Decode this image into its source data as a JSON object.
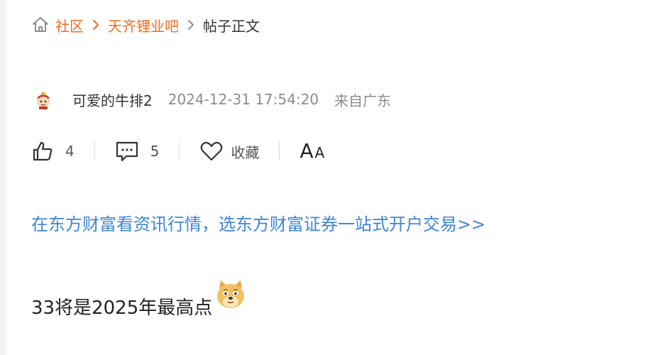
{
  "breadcrumb": {
    "home_icon": "home-icon",
    "items": [
      {
        "label": "社区"
      },
      {
        "label": "天齐锂业吧"
      }
    ],
    "current": "帖子正文",
    "separator_icon": "chevron-right-icon"
  },
  "author": {
    "avatar_icon": "avatar",
    "name": "可爱的牛排2",
    "time": "2024-12-31 17:54:20",
    "location": "来自广东"
  },
  "actions": {
    "like": {
      "icon": "thumbs-up-icon",
      "count": "4"
    },
    "comment": {
      "icon": "comment-icon",
      "count": "5"
    },
    "favorite": {
      "icon": "heart-icon",
      "label": "收藏"
    },
    "font_size": {
      "big": "A",
      "small": "A"
    }
  },
  "promo": {
    "text": "在东方财富看资讯行情，选东方财富证券一站式开户交易>>"
  },
  "post": {
    "text": "33将是2025年最高点",
    "emoji_icon": "doge-emoji-icon"
  },
  "colors": {
    "accent": "#f2691f",
    "link": "#3d85d6",
    "muted": "#8c8c8c",
    "text": "#333333"
  }
}
